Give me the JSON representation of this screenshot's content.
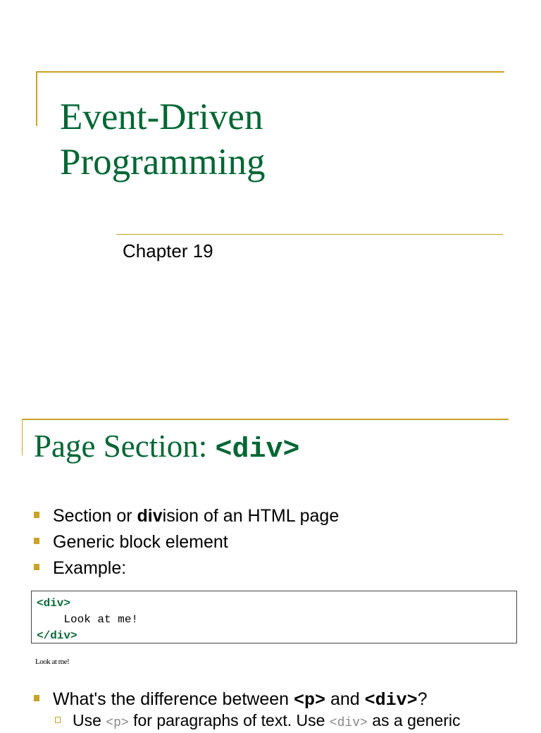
{
  "slide1": {
    "title_line1": "Event-Driven",
    "title_line2": "Programming",
    "subtitle": "Chapter 19"
  },
  "slide2": {
    "title_text": "Page Section: ",
    "title_code": "<div>",
    "bullets": [
      {
        "pre": "Section or ",
        "bold": "div",
        "post": "ision of an HTML page"
      },
      {
        "text": "Generic block element"
      },
      {
        "text": "Example:"
      }
    ],
    "code_lines": [
      "<div>",
      "    Look at me!",
      "</div>"
    ],
    "rendered_output": "Look at me!",
    "question": {
      "pre": "What's the difference between ",
      "code1": "<p>",
      "mid": " and ",
      "code2": "<div>",
      "post": "?"
    },
    "sub_bullet": {
      "pre": "Use ",
      "code1": "<p>",
      "mid": " for paragraphs of text. Use ",
      "code2": "<div>",
      "post": " as a generic"
    }
  },
  "colors": {
    "accent": "#c9a227",
    "title": "#006633"
  }
}
